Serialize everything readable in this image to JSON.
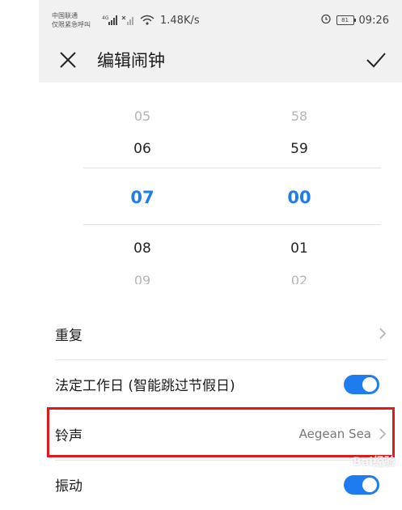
{
  "status_bar": {
    "carrier_line1": "中国联通",
    "carrier_line2": "仅限紧急呼叫",
    "signal_4g": "4G",
    "network_speed": "1.48K/s",
    "battery_level": "81",
    "time": "09:26"
  },
  "title_bar": {
    "title": "编辑闹钟",
    "close_icon": "close-icon",
    "confirm_icon": "checkmark-icon"
  },
  "time_picker": {
    "hours": [
      "05",
      "06",
      "07",
      "08",
      "09"
    ],
    "minutes": [
      "58",
      "59",
      "00",
      "01",
      "02"
    ],
    "selected_hour": "07",
    "selected_minute": "00",
    "accent_color": "#1e7cf0"
  },
  "settings": {
    "repeat": {
      "label": "重复"
    },
    "workday": {
      "label": "法定工作日 (智能跳过节假日)",
      "enabled": true
    },
    "ringtone": {
      "label": "铃声",
      "value": "Aegean Sea"
    },
    "vibrate": {
      "label": "振动",
      "enabled": true
    }
  },
  "highlight_color": "#e0191b",
  "watermark": "Bai经验"
}
